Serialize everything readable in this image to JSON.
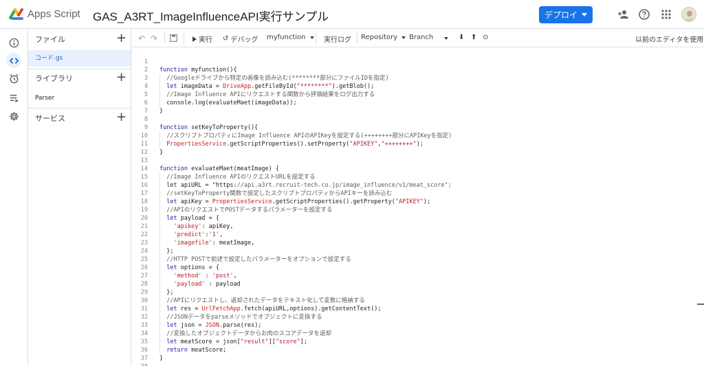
{
  "header": {
    "app_name": "Apps Script",
    "project_title": "GAS_A3RT_ImageInfluenceAPI実行サンプル",
    "deploy_label": "デプロイ",
    "icons": [
      "add-person-icon",
      "help-icon",
      "apps-grid-icon",
      "account-avatar"
    ],
    "accent": "#1a73e8"
  },
  "rail": {
    "icons": [
      "info-icon",
      "code-icon",
      "alarm-icon",
      "executions-icon",
      "settings-icon"
    ]
  },
  "files_panel": {
    "files_label": "ファイル",
    "files": [
      "コード.gs"
    ],
    "libraries_label": "ライブラリ",
    "libraries": [
      "Parser"
    ],
    "services_label": "サービス"
  },
  "toolbar": {
    "run_label": "実行",
    "debug_label": "デバッグ",
    "function_select": "myfunction",
    "log_label": "実行ログ",
    "repository_label": "Repository",
    "branch_label": "Branch",
    "legacy_label": "以前のエディタを使用"
  },
  "code": [
    "",
    "function myfunction(){",
    "  //Googleドライブから特定の画像を読み込む(********部分にファイルIDを指定)",
    "  let imageData = DriveApp.getFileById(\"********\").getBlob();",
    "  //Image Influence APIにリクエストする関数から評価結果をログ出力する",
    "  console.log(evaluateMaet(imageData));",
    "}",
    "",
    "function setKeyToProperty(){",
    "  //スクリプトプロパティにImage Influence APIのAPIKeyを設定する(++++++++部分にAPIKeyを指定)",
    "  PropertiesService.getScriptProperties().setProperty(\"APIKEY\",\"++++++++\");",
    "}",
    "",
    "function evaluateMaet(meatImage) {",
    "  //Image Influence APIのリクエストURLを設定する",
    "  let apiURL = \"https://api.a3rt.recruit-tech.co.jp/image_influence/v1/meat_score\";",
    "  //setKeyToProperty関数で設定したスクリプトプロパティからAPIキーを読み込む",
    "  let apiKey = PropertiesService.getScriptProperties().getProperty(\"APIKEY\");",
    "  //APIのリクエストでPOSTデータするパラメーターを設定する",
    "  let payload = {",
    "    'apikey': apiKey,",
    "    'predict':'1',",
    "    'imagefile': meatImage,",
    "  };",
    "  //HTTP POSTで前述で設定したパラメーターをオプションで設定する",
    "  let options = {",
    "    'method' : 'post',",
    "    'payload' : payload",
    "  };",
    "  //APIにリクエストし、返却されたデータをテキスト化して変数に格納する",
    "  let res = UrlFetchApp.fetch(apiURL,options).getContentText();",
    "  //JSONデータをparseメソッドでオブジェクトに変換する",
    "  let json = JSON.parse(res);",
    "  //変換したオブジェクトデータからお肉のスコアデータを返却",
    "  let meatScore = json[\"result\"][\"score\"];",
    "  return meatScore;",
    "}",
    ""
  ],
  "syntax_colors": {
    "keyword": "#1a1aa6",
    "comment": "#5c5c5c",
    "string": "#b5202c",
    "builtin": "#c5221f",
    "line_number": "#888888"
  }
}
